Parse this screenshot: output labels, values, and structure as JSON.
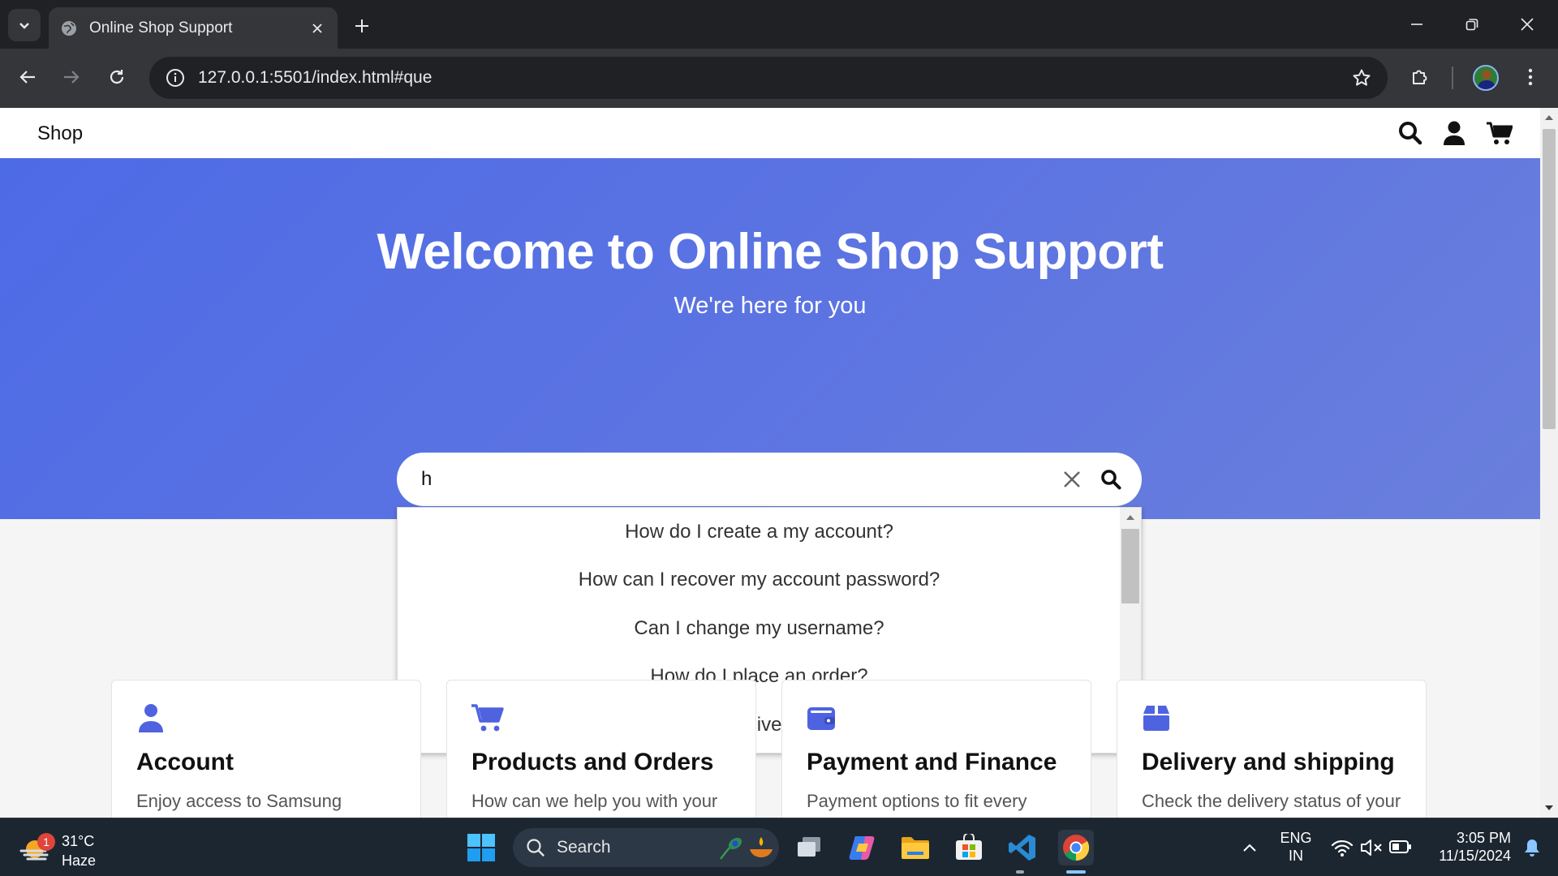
{
  "browser": {
    "tab_title": "Online Shop Support",
    "url": "127.0.0.1:5501/index.html#que"
  },
  "header": {
    "brand": "Shop"
  },
  "hero": {
    "title": "Welcome to Online Shop Support",
    "subtitle": "We're here for you"
  },
  "search": {
    "value": "h",
    "suggestions": [
      "How do I create a my account?",
      "How can I recover my account password?",
      "Can I change my username?",
      "How do I place an order?",
      "What should I do if I received a damaged product?"
    ]
  },
  "cards": [
    {
      "icon": "user-icon",
      "title": "Account",
      "desc": "Enjoy access to Samsung services and applications"
    },
    {
      "icon": "cart-icon",
      "title": "Products and Orders",
      "desc": "How can we help you with your order?"
    },
    {
      "icon": "wallet-icon",
      "title": "Payment and Finance",
      "desc": "Payment options to fit every pocket"
    },
    {
      "icon": "box-icon",
      "title": "Delivery and shipping",
      "desc": "Check the delivery status of your orders"
    }
  ],
  "taskbar": {
    "weather_temp": "31°C",
    "weather_desc": "Haze",
    "weather_badge": "1",
    "search_label": "Search",
    "lang_top": "ENG",
    "lang_bottom": "IN",
    "time": "3:05 PM",
    "date": "11/15/2024"
  },
  "colors": {
    "accent": "#4e6be6",
    "card_icon": "#4f63e0"
  }
}
